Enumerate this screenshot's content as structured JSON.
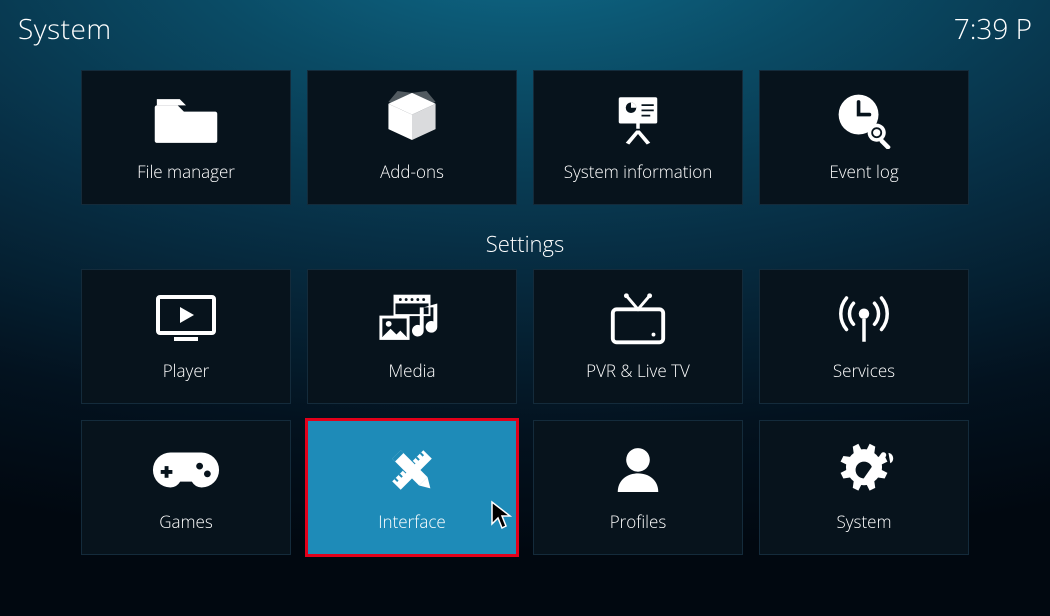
{
  "header": {
    "title": "System",
    "clock": "7:39 P"
  },
  "top": {
    "items": [
      {
        "id": "file-manager",
        "label": "File manager"
      },
      {
        "id": "add-ons",
        "label": "Add-ons"
      },
      {
        "id": "system-information",
        "label": "System information"
      },
      {
        "id": "event-log",
        "label": "Event log"
      }
    ]
  },
  "section_label": "Settings",
  "settings": {
    "rows": [
      [
        {
          "id": "player",
          "label": "Player"
        },
        {
          "id": "media",
          "label": "Media"
        },
        {
          "id": "pvr",
          "label": "PVR & Live TV"
        },
        {
          "id": "services",
          "label": "Services"
        }
      ],
      [
        {
          "id": "games",
          "label": "Games"
        },
        {
          "id": "interface",
          "label": "Interface",
          "selected": true
        },
        {
          "id": "profiles",
          "label": "Profiles"
        },
        {
          "id": "system",
          "label": "System"
        }
      ]
    ]
  }
}
